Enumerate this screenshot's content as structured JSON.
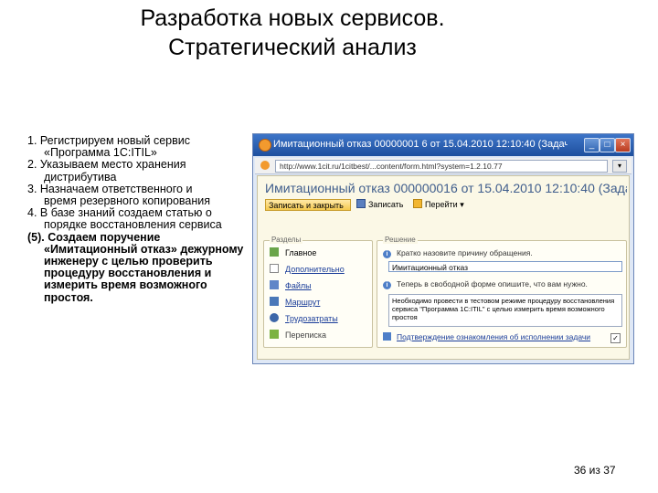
{
  "title": {
    "line1": "Разработка новых сервисов.",
    "line2": "Стратегический анализ"
  },
  "steps": [
    {
      "text": "1. Регистрируем новый сервис",
      "cont": "«Программа 1С:ITIL»"
    },
    {
      "text": "2. Указываем место хранения",
      "cont": "дистрибутива"
    },
    {
      "text": "3. Назначаем ответственного и",
      "cont": "время резервного копирования"
    },
    {
      "text": "4. В базе знаний создаем статью о",
      "cont": "порядке восстановления сервиса"
    },
    {
      "text": "(5). Создаем поручение",
      "cont": "«Имитационный отказ» дежурному инженеру с целью проверить процедуру восстановления и измерить время возможного простоя."
    }
  ],
  "pager": "36 из 37",
  "window": {
    "titlebar": "Имитационный отказ 00000001 6 от 15.04.2010 12:10:40 (Задача) 1...",
    "controls": {
      "minimize": "_",
      "maximize": "□",
      "close": "×"
    },
    "address": "http://www.1cit.ru/1citbest/...content/form.html?system=1.2.10.77",
    "address_btn": "▾",
    "form_title": "Имитационный отказ 000000016 от 15.04.2010 12:10:40 (Задач",
    "toolbar": {
      "save_close": "Записать и закрыть",
      "save": "Записать",
      "goto": "Перейти"
    },
    "nav_label": "Разделы",
    "nav_items": [
      {
        "label": "Главное",
        "icon": "home-icon"
      },
      {
        "label": "Дополнительно",
        "icon": "document-icon"
      },
      {
        "label": "Файлы",
        "icon": "files-icon"
      },
      {
        "label": "Маршрут",
        "icon": "route-icon"
      },
      {
        "label": "Трудозатраты",
        "icon": "time-icon"
      },
      {
        "label": "Переписка",
        "icon": "mail-icon"
      }
    ],
    "details_label": "Решение",
    "hint1": "Кратко назовите причину обращения.",
    "field1": "Имитационный отказ",
    "hint2": "Теперь в свободной форме опишите, что вам нужно.",
    "description": "Необходимо провести в тестовом режиме процедуру восстановления сервиса \"Программа 1С:ITIL\" с целью измерить время возможного простоя",
    "bottom_link": "Подтверждение ознакомления об исполнении задачи"
  }
}
